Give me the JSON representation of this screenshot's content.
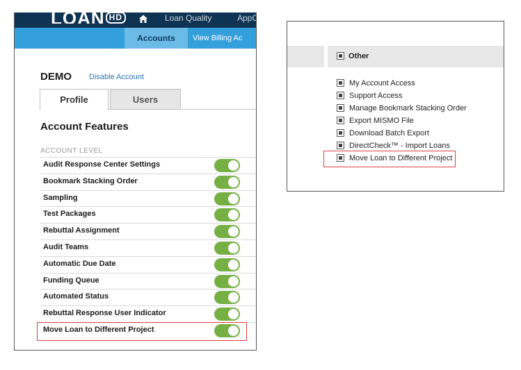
{
  "topbar": {
    "logo_main": "LOAN",
    "logo_badge": "HD",
    "nav": [
      "Loan Quality",
      "AppC"
    ]
  },
  "tabs": {
    "accounts": "Accounts",
    "billing": "View Billing Ac"
  },
  "account": {
    "name": "DEMO",
    "disable_link": "Disable Account"
  },
  "subtabs": {
    "profile": "Profile",
    "users": "Users"
  },
  "features": {
    "heading": "Account Features",
    "level_label": "ACCOUNT LEVEL",
    "items": [
      {
        "label": "Audit Response Center Settings",
        "enabled": true
      },
      {
        "label": "Bookmark Stacking Order",
        "enabled": true
      },
      {
        "label": "Sampling",
        "enabled": true
      },
      {
        "label": "Test Packages",
        "enabled": true
      },
      {
        "label": "Rebuttal Assignment",
        "enabled": true
      },
      {
        "label": "Audit Teams",
        "enabled": true
      },
      {
        "label": "Automatic Due Date",
        "enabled": true
      },
      {
        "label": "Funding Queue",
        "enabled": true
      },
      {
        "label": "Automated Status",
        "enabled": true
      },
      {
        "label": "Rebuttal Response User Indicator",
        "enabled": true
      },
      {
        "label": "Move Loan to Different Project",
        "enabled": true
      }
    ]
  },
  "permissions": {
    "group_label": "Other",
    "items": [
      "My Account Access",
      "Support Access",
      "Manage Bookmark Stacking Order",
      "Export MISMO File",
      "Download Batch Export",
      "DirectCheck™ - Import Loans",
      "Move Loan to Different Project"
    ]
  },
  "colors": {
    "topbar": "#0f3352",
    "tabbar": "#33a0dc",
    "active_tab": "#6cbbe7",
    "toggle_on": "#76b044",
    "highlight": "#e03c3c",
    "link": "#2d74b8"
  },
  "icons": {
    "home": "home-icon",
    "checkbox": "checkbox-icon",
    "toggle": "toggle-switch"
  }
}
